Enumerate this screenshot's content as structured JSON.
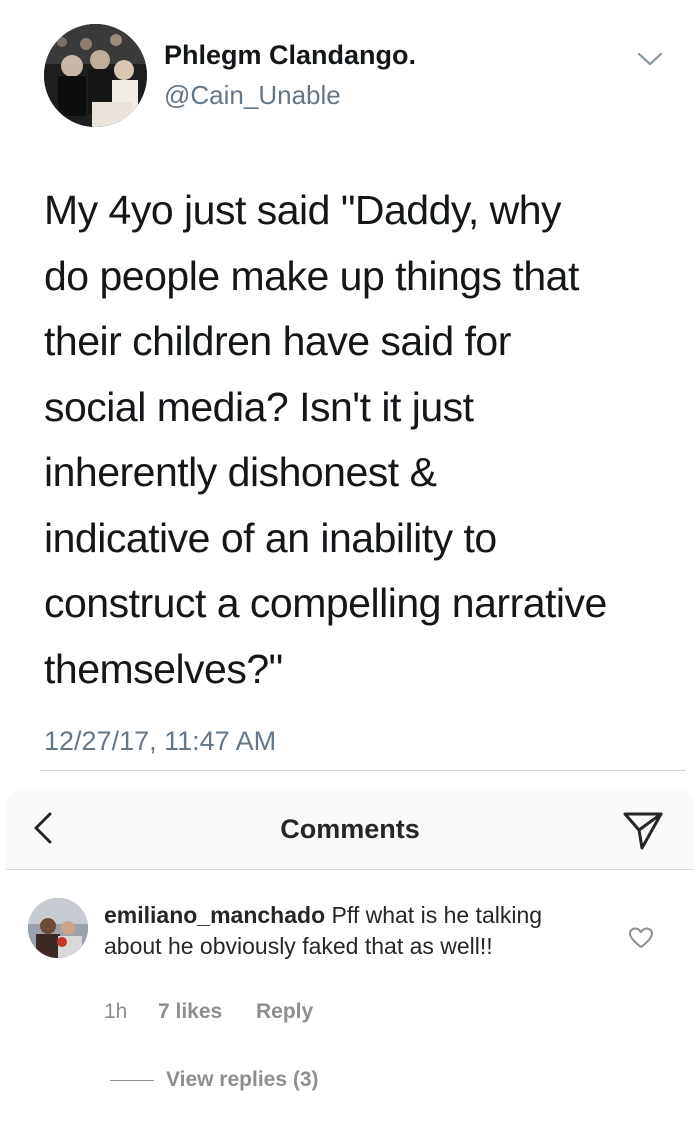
{
  "tweet": {
    "display_name": "Phlegm Clandango.",
    "handle": "@Cain_Unable",
    "text_lines": [
      "My 4yo just said \"Daddy, why",
      "do  people make up things that",
      "their children have said for",
      "social media? Isn't it just",
      "inherently dishonest &",
      "indicative of an inability to",
      "construct a compelling narrative",
      "themselves?\""
    ],
    "timestamp": "12/27/17, 11:47 AM",
    "icons": {
      "avatar": "avatar-photo",
      "menu": "chevron-down-icon"
    }
  },
  "instagram": {
    "title": "Comments",
    "icons": {
      "back": "chevron-left-icon",
      "share": "send-icon"
    },
    "comment": {
      "username": "emiliano_manchado",
      "text": " Pff what is he talking about he obviously faked that as well!!",
      "time": "1h",
      "likes": "7 likes",
      "reply": "Reply",
      "view_replies": "View replies (3)",
      "icons": {
        "like": "heart-icon"
      }
    }
  },
  "colors": {
    "text": "#14171a",
    "secondary": "#657786",
    "ig_text": "#262626",
    "ig_secondary": "#8e8e8e",
    "ig_header_bg": "#fafafa"
  }
}
